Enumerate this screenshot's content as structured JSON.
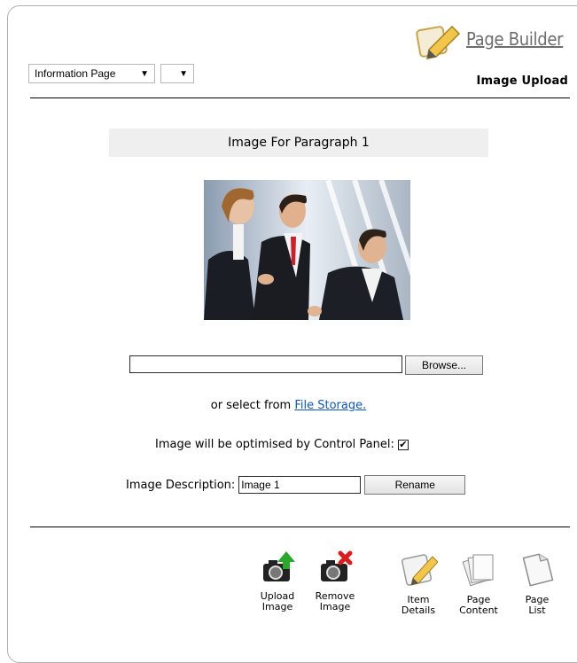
{
  "app": {
    "logo_text": "Page Builder",
    "page_heading": "Image Upload"
  },
  "header": {
    "page_type_select": {
      "value": "Information Page"
    },
    "secondary_select": {
      "value": ""
    }
  },
  "main": {
    "title": "Image For Paragraph 1",
    "file_input": {
      "value": "",
      "browse_label": "Browse..."
    },
    "file_storage": {
      "prefix": "or select from",
      "link_text": "File Storage."
    },
    "optimise": {
      "label": "Image will be optimised by Control Panel:",
      "checked": true,
      "check_glyph": "✔"
    },
    "description": {
      "label": "Image Description:",
      "value": "Image 1",
      "rename_label": "Rename"
    }
  },
  "toolbar": {
    "items": [
      {
        "label": "Upload\nImage",
        "icon": "camera-upload-icon"
      },
      {
        "label": "Remove\nImage",
        "icon": "camera-remove-icon"
      },
      {
        "label": "Item\nDetails",
        "icon": "pencil-document-icon"
      },
      {
        "label": "Page\nContent",
        "icon": "document-stack-icon"
      },
      {
        "label": "Page\nList",
        "icon": "document-icon"
      }
    ]
  },
  "colors": {
    "link": "#0b57c9",
    "title_bar_bg": "#efefef",
    "upload_arrow": "#2aa82a",
    "remove_x": "#e01b1b"
  }
}
